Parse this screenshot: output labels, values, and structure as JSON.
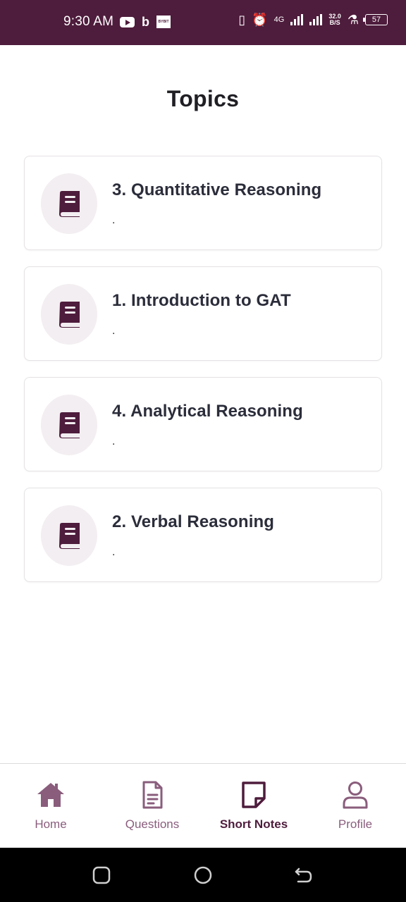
{
  "status_bar": {
    "time": "9:30 AM",
    "network_type": "4G",
    "net_speed_value": "32.0",
    "net_speed_unit": "B/S",
    "battery": "57",
    "background_color": "#4e1c3c"
  },
  "page": {
    "title": "Topics"
  },
  "topics": [
    {
      "title": "3. Quantitative Reasoning",
      "subtitle": ".",
      "icon": "book-icon"
    },
    {
      "title": "1. Introduction to GAT",
      "subtitle": ".",
      "icon": "book-icon"
    },
    {
      "title": "4. Analytical Reasoning",
      "subtitle": ".",
      "icon": "book-icon"
    },
    {
      "title": "2. Verbal Reasoning",
      "subtitle": ".",
      "icon": "book-icon"
    }
  ],
  "bottom_nav": {
    "items": [
      {
        "label": "Home",
        "icon": "home-icon",
        "active": false
      },
      {
        "label": "Questions",
        "icon": "document-icon",
        "active": false
      },
      {
        "label": "Short Notes",
        "icon": "note-icon",
        "active": true
      },
      {
        "label": "Profile",
        "icon": "profile-icon",
        "active": false
      }
    ]
  },
  "colors": {
    "primary": "#4e1c3c",
    "inactive_nav": "#8a5d7c",
    "card_icon_bg": "#f3eef1",
    "text_dark": "#2b2d3a"
  }
}
